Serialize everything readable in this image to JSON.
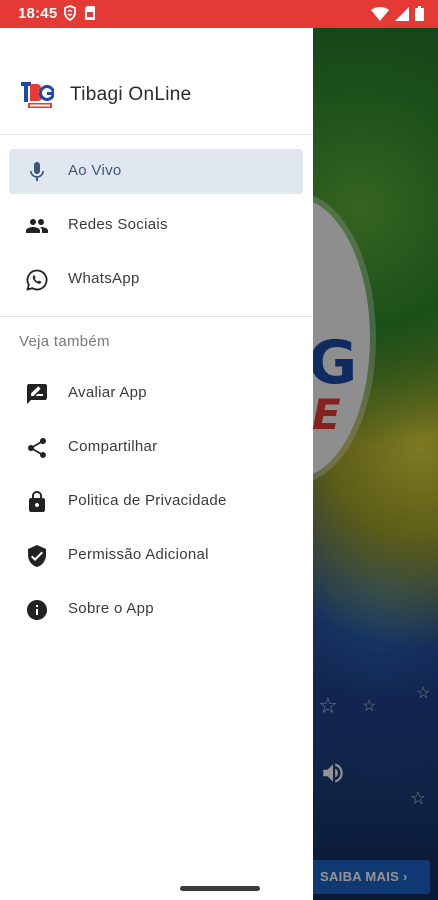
{
  "status_bar": {
    "time": "18:45",
    "left_icons": [
      "shield-icon",
      "sim-card-icon"
    ],
    "right_icons": [
      "wifi-icon",
      "signal-icon",
      "battery-icon"
    ],
    "color": "#e53935"
  },
  "drawer": {
    "app_title": "Tibagi OnLine",
    "main_items": [
      {
        "label": "Ao Vivo",
        "icon": "microphone-icon",
        "active": true
      },
      {
        "label": "Redes Sociais",
        "icon": "people-icon",
        "active": false
      },
      {
        "label": "WhatsApp",
        "icon": "whatsapp-icon",
        "active": false
      }
    ],
    "section_title": "Veja também",
    "more_items": [
      {
        "label": "Avaliar App",
        "icon": "rate-review-icon"
      },
      {
        "label": "Compartilhar",
        "icon": "share-icon"
      },
      {
        "label": "Politica de Privacidade",
        "icon": "lock-icon"
      },
      {
        "label": "Permissão Adicional",
        "icon": "verified-shield-icon"
      },
      {
        "label": "Sobre o App",
        "icon": "info-icon"
      }
    ]
  },
  "background": {
    "button_label": "SAIBA MAIS ›",
    "logo_letters": {
      "top": "G",
      "bottom": "E"
    }
  },
  "colors": {
    "active_item_bg": "#e1e7f0",
    "active_icon": "#3f5778",
    "button_blue": "#1c63c9"
  }
}
